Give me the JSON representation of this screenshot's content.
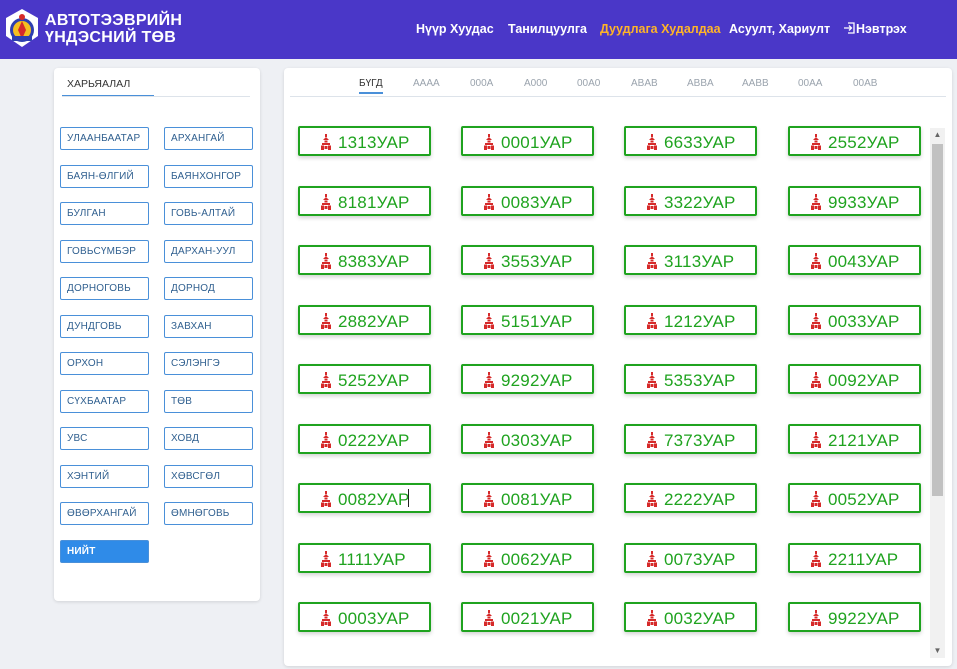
{
  "header": {
    "brand_line1": "АВТОТЭЭВРИЙН",
    "brand_line2": "ҮНДЭСНИЙ ТӨВ",
    "nav": [
      "Нүүр Хуудас",
      "Танилцуулга",
      "Дуудлага Худалдаа",
      "Асуулт, Хариулт",
      "Нэвтрэх"
    ],
    "active_nav": "Дуудлага Худалдаа",
    "colors": {
      "bar": "#4a37c8",
      "active": "#ffb428"
    }
  },
  "sidebar": {
    "tab": "ХАРЬЯАЛАЛ",
    "regions": [
      "УЛААНБААТАР",
      "АРХАНГАЙ",
      "БАЯН-ӨЛГИЙ",
      "БАЯНХОНГОР",
      "БУЛГАН",
      "ГОВЬ-АЛТАЙ",
      "ГОВЬСҮМБЭР",
      "ДАРХАН-УУЛ",
      "ДОРНОГОВЬ",
      "ДОРНОД",
      "ДУНДГОВЬ",
      "ЗАВХАН",
      "ОРХОН",
      "СЭЛЭНГЭ",
      "СҮХБААТАР",
      "ТӨВ",
      "УВС",
      "ХОВД",
      "ХЭНТИЙ",
      "ХӨВСГӨЛ",
      "ӨВӨРХАНГАЙ",
      "ӨМНӨГОВЬ"
    ],
    "all_button": "НИЙТ"
  },
  "filter_tabs": [
    "БҮГД",
    "AAAA",
    "000A",
    "A000",
    "00A0",
    "ABAB",
    "ABBA",
    "AABB",
    "00AA",
    "00AB"
  ],
  "active_filter": "БҮГД",
  "plates": [
    "1313УАР",
    "0001УАР",
    "6633УАР",
    "2552УАР",
    "8181УАР",
    "0083УАР",
    "3322УАР",
    "9933УАР",
    "8383УАР",
    "3553УАР",
    "3113УАР",
    "0043УАР",
    "2882УАР",
    "5151УАР",
    "1212УАР",
    "0033УАР",
    "5252УАР",
    "9292УАР",
    "5353УАР",
    "0092УАР",
    "0222УАР",
    "0303УАР",
    "7373УАР",
    "2121УАР",
    "0082УАР",
    "0081УАР",
    "2222УАР",
    "0052УАР",
    "1111УАР",
    "0062УАР",
    "0073УАР",
    "2211УАР",
    "0003УАР",
    "0021УАР",
    "0032УАР",
    "9922УАР"
  ],
  "plate_color": "#1fa31f",
  "emblem_color": "#d62a2a",
  "icons": {
    "logo": "soyombo-logo-icon",
    "login": "login-icon",
    "plate": "soyombo-emblem-icon"
  }
}
